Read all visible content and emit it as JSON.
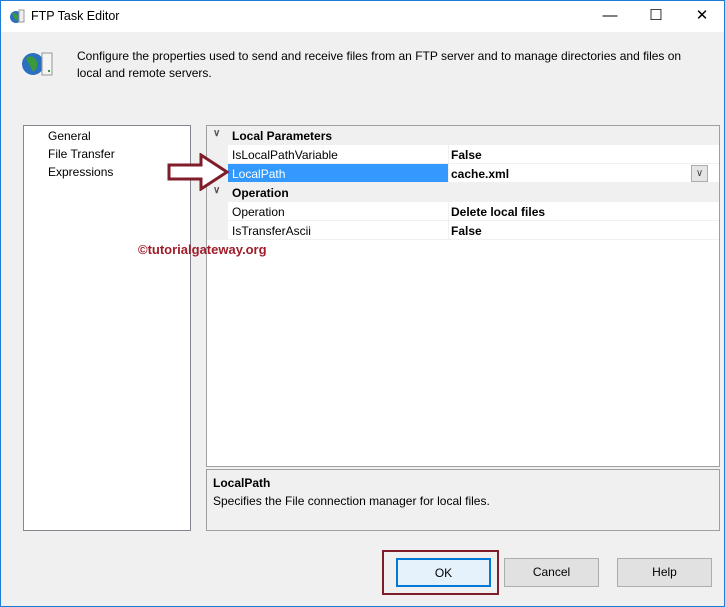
{
  "window": {
    "title": "FTP Task Editor",
    "minimize_icon": "minimize-icon",
    "maximize_icon": "maximize-icon",
    "close_icon": "close-icon"
  },
  "description": "Configure the properties used to send and receive files from an FTP server and to manage directories and files on local and remote servers.",
  "nav": {
    "items": [
      {
        "label": "General"
      },
      {
        "label": "File Transfer"
      },
      {
        "label": "Expressions"
      }
    ]
  },
  "grid": {
    "categories": [
      {
        "label": "Local Parameters",
        "rows": [
          {
            "name": "IsLocalPathVariable",
            "value": "False"
          },
          {
            "name": "LocalPath",
            "value": "cache.xml"
          }
        ]
      },
      {
        "label": "Operation",
        "rows": [
          {
            "name": "Operation",
            "value": "Delete local files"
          },
          {
            "name": "IsTransferAscii",
            "value": "False"
          }
        ]
      }
    ]
  },
  "watermark": "©tutorialgateway.org",
  "help": {
    "title": "LocalPath",
    "text": "Specifies the File connection manager for local files."
  },
  "buttons": {
    "ok": "OK",
    "cancel": "Cancel",
    "help": "Help"
  },
  "colors": {
    "selection": "#3399ff",
    "annotation": "#7f1d2a"
  }
}
